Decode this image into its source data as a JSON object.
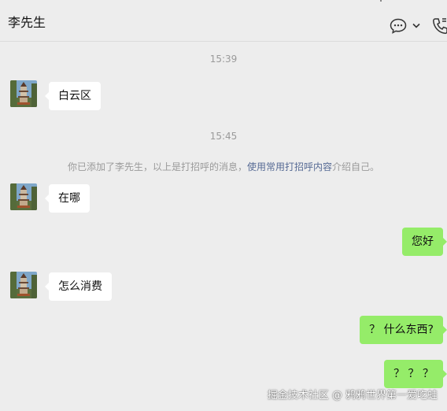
{
  "header": {
    "contact_name": "李先生",
    "icons": [
      "pin-icon",
      "minimize-icon",
      "chat-bubble-more-icon",
      "chevron-down-icon",
      "voice-call-icon"
    ]
  },
  "chat": {
    "time_1": "15:39",
    "msg_1": "白云区",
    "time_2": "15:45",
    "system": {
      "prefix": "你已添加了李先生，以上是打招呼的消息，",
      "link": "使用常用打招呼内容",
      "suffix": "介绍自己。"
    },
    "msg_2": "在哪",
    "msg_3": "您好",
    "msg_4": "怎么消费",
    "msg_5": "？ 什么东西?",
    "msg_6": "？ ？ ？"
  },
  "watermark": "掘金技术社区 @ 鸦鸦世界第一爱吃蛙",
  "colors": {
    "background": "#ededed",
    "incoming_bubble": "#ffffff",
    "outgoing_bubble": "#95ec69",
    "link": "#576b95",
    "meta_text": "#9a9a9a"
  }
}
